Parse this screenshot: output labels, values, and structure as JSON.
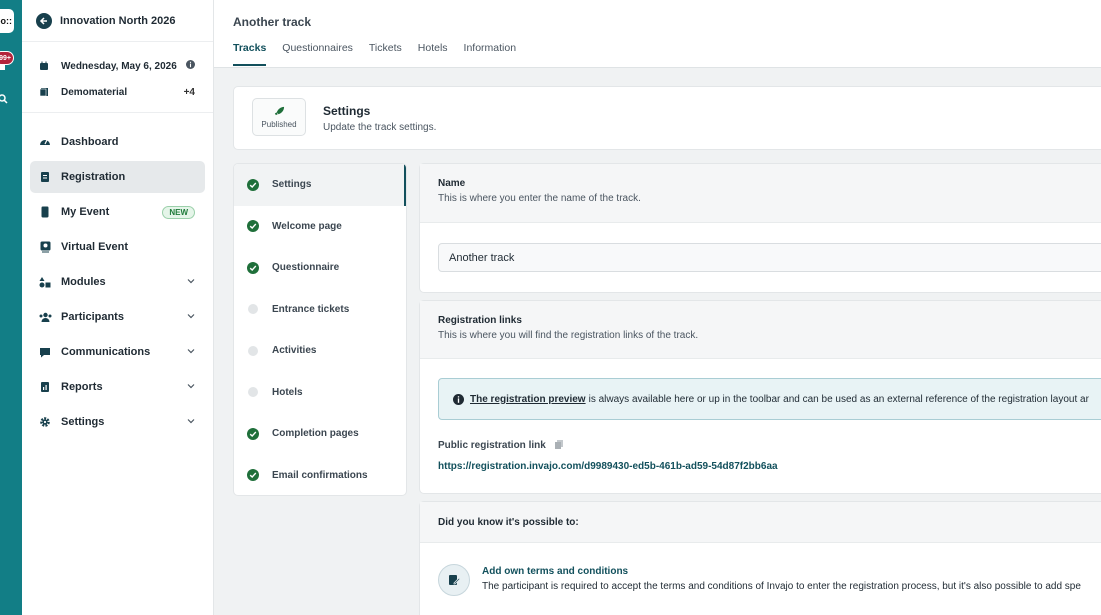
{
  "rail": {
    "logo_text": "bo::",
    "notification_badge": "99+"
  },
  "event": {
    "title": "Innovation North 2026",
    "date": "Wednesday, May 6, 2026",
    "material": "Demomaterial",
    "material_extra": "+4"
  },
  "nav": {
    "dashboard": "Dashboard",
    "registration": "Registration",
    "my_event": "My Event",
    "new_badge": "NEW",
    "virtual_event": "Virtual Event",
    "modules": "Modules",
    "participants": "Participants",
    "communications": "Communications",
    "reports": "Reports",
    "settings": "Settings"
  },
  "page": {
    "title": "Another track",
    "tabs": [
      "Tracks",
      "Questionnaires",
      "Tickets",
      "Hotels",
      "Information"
    ]
  },
  "settings_card": {
    "status": "Published",
    "title": "Settings",
    "subtitle": "Update the track settings."
  },
  "steps": [
    {
      "label": "Settings",
      "done": true
    },
    {
      "label": "Welcome page",
      "done": true
    },
    {
      "label": "Questionnaire",
      "done": true
    },
    {
      "label": "Entrance tickets",
      "done": false
    },
    {
      "label": "Activities",
      "done": false
    },
    {
      "label": "Hotels",
      "done": false
    },
    {
      "label": "Completion pages",
      "done": true
    },
    {
      "label": "Email confirmations",
      "done": true
    }
  ],
  "name_section": {
    "title": "Name",
    "subtitle": "This is where you enter the name of the track.",
    "value": "Another track"
  },
  "links_section": {
    "title": "Registration links",
    "subtitle": "This is where you will find the registration links of the track.",
    "info_link": "The registration preview",
    "info_rest": "is always available here or up in the toolbar and can be used as an external reference of the registration layout ar",
    "public_label": "Public registration link",
    "public_url": "https://registration.invajo.com/d9989430-ed5b-461b-ad59-54d87f2bb6aa"
  },
  "tips_section": {
    "title": "Did you know it's possible to:",
    "tip_title": "Add own terms and conditions",
    "tip_desc": "The participant is required to accept the terms and conditions of Invajo to enter the registration process, but it's also possible to add spe"
  },
  "colors": {
    "accent": "#12505c",
    "rail": "#127e86",
    "success": "#1f6f3a",
    "badge": "#b3243b"
  }
}
